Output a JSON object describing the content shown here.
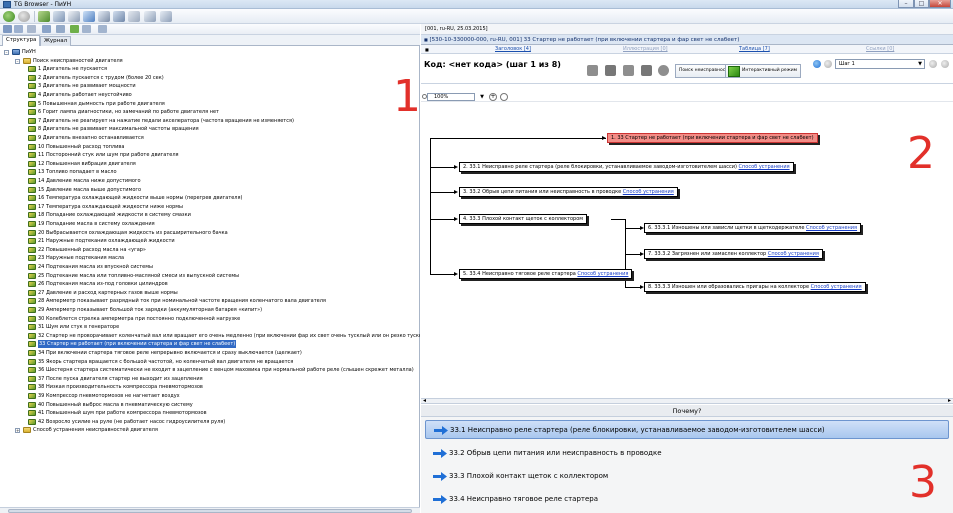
{
  "window": {
    "title": "TG Browser - ПиУН",
    "btn_min": "–",
    "btn_max": "□",
    "btn_close": "✕"
  },
  "left": {
    "tabs": [
      "Структура",
      "Журнал"
    ],
    "tree": [
      {
        "level": 0,
        "kind": "root",
        "label": "ПиУН",
        "exp": "–"
      },
      {
        "level": 1,
        "kind": "fold",
        "label": "Поиск неисправностей двигателя",
        "exp": "–"
      },
      {
        "level": 2,
        "kind": "leaf",
        "label": "1 Двигатель не пускается"
      },
      {
        "level": 2,
        "kind": "leaf",
        "label": "2 Двигатель пускается с трудом (более 20 сек)"
      },
      {
        "level": 2,
        "kind": "leaf",
        "label": "3 Двигатель не развивает мощности"
      },
      {
        "level": 2,
        "kind": "leaf",
        "label": "4 Двигатель работает неустойчиво"
      },
      {
        "level": 2,
        "kind": "leaf",
        "label": "5 Повышенная дымность при работе двигателя"
      },
      {
        "level": 2,
        "kind": "leaf",
        "label": "6 Горит лампа диагностики, но замечаний по работе двигателя нет"
      },
      {
        "level": 2,
        "kind": "leaf",
        "label": "7 Двигатель не реагирует на нажатие педали акселератора (частота вращения не изменяется)"
      },
      {
        "level": 2,
        "kind": "leaf",
        "label": "8 Двигатель не развивает максимальной частоты вращения"
      },
      {
        "level": 2,
        "kind": "leaf",
        "label": "9 Двигатель внезапно останавливается"
      },
      {
        "level": 2,
        "kind": "leaf",
        "label": "10 Повышенный расход топлива"
      },
      {
        "level": 2,
        "kind": "leaf",
        "label": "11 Посторонний стук или шум при работе двигателя"
      },
      {
        "level": 2,
        "kind": "leaf",
        "label": "12 Повышенная вибрация двигателя"
      },
      {
        "level": 2,
        "kind": "leaf",
        "label": "13 Топливо попадает в масло"
      },
      {
        "level": 2,
        "kind": "leaf",
        "label": "14 Давление масла ниже допустимого"
      },
      {
        "level": 2,
        "kind": "leaf",
        "label": "15 Давление масла выше допустимого"
      },
      {
        "level": 2,
        "kind": "leaf",
        "label": "16 Температура охлаждающей жидкости выше нормы (перегрев двигателя)"
      },
      {
        "level": 2,
        "kind": "leaf",
        "label": "17 Температура охлаждающей жидкости ниже нормы"
      },
      {
        "level": 2,
        "kind": "leaf",
        "label": "18 Попадание охлаждающей жидкости в систему смазки"
      },
      {
        "level": 2,
        "kind": "leaf",
        "label": "19 Попадание масла в систему охлаждения"
      },
      {
        "level": 2,
        "kind": "leaf",
        "label": "20 Выбрасывается охлаждающая жидкость из расширительного бачка"
      },
      {
        "level": 2,
        "kind": "leaf",
        "label": "21 Наружные подтекания охлаждающей жидкости"
      },
      {
        "level": 2,
        "kind": "leaf",
        "label": "22 Повышенный расход масла на «угар»"
      },
      {
        "level": 2,
        "kind": "leaf",
        "label": "23 Наружные подтекания масла"
      },
      {
        "level": 2,
        "kind": "leaf",
        "label": "24 Подтекания масла из впускной системы"
      },
      {
        "level": 2,
        "kind": "leaf",
        "label": "25 Подтекание масла или топливно-масляной смеси из выпускной системы"
      },
      {
        "level": 2,
        "kind": "leaf",
        "label": "26 Подтекания масла из-под головки цилиндров"
      },
      {
        "level": 2,
        "kind": "leaf",
        "label": "27 Давление и расход картерных газов выше нормы"
      },
      {
        "level": 2,
        "kind": "leaf",
        "label": "28 Амперметр показывает разрядный ток при номинальной частоте вращения коленчатого вала двигателя"
      },
      {
        "level": 2,
        "kind": "leaf",
        "label": "29 Амперметр показывает большой ток зарядки (аккумуляторная батарея «кипит»)"
      },
      {
        "level": 2,
        "kind": "leaf",
        "label": "30 Колеблется стрелка амперметра при постоянно подключенной нагрузке"
      },
      {
        "level": 2,
        "kind": "leaf",
        "label": "31 Шум или стук в генераторе"
      },
      {
        "level": 2,
        "kind": "leaf",
        "label": "32 Стартер не проворачивает коленчатый вал или вращает его очень медленно (при включении фар их свет очень тусклый или он резко тускнеет)"
      },
      {
        "level": 2,
        "kind": "leaf",
        "label": "33 Стартер не работает (при включении стартера и фар свет не слабеет)",
        "selected": true
      },
      {
        "level": 2,
        "kind": "leaf",
        "label": "34 При включении стартера тяговое реле непрерывно включается и сразу выключается (щелкает)"
      },
      {
        "level": 2,
        "kind": "leaf",
        "label": "35 Якорь стартера вращается с большой частотой, но коленчатый вал двигателя не вращается"
      },
      {
        "level": 2,
        "kind": "leaf",
        "label": "36 Шестерня стартера систематически не входит в зацепление с венцом маховика при нормальной работе реле (слышен скрежет металла)"
      },
      {
        "level": 2,
        "kind": "leaf",
        "label": "37 После пуска двигателя стартер не выходит из зацепления"
      },
      {
        "level": 2,
        "kind": "leaf",
        "label": "38 Низкая производительность компрессора пневмотормозов"
      },
      {
        "level": 2,
        "kind": "leaf",
        "label": "39 Компрессор пневмотормозов не нагнетает воздух"
      },
      {
        "level": 2,
        "kind": "leaf",
        "label": "40 Повышенный выброс масла в пневматическую систему"
      },
      {
        "level": 2,
        "kind": "leaf",
        "label": "41 Повышенный шум при работе компрессора пневмотормозов"
      },
      {
        "level": 2,
        "kind": "leaf",
        "label": "42 Возросло усилие на руле (не работает насос гидроусилителя руля)"
      },
      {
        "level": 1,
        "kind": "fold",
        "label": "Способ устранения неисправностей двигателя",
        "exp": "+"
      }
    ]
  },
  "annotations": {
    "n1": "1",
    "n2": "2",
    "n3": "3"
  },
  "right": {
    "path": "[001, ru-RU, 25.03.2015]",
    "header": "[530-10-330000-000, ru-RU, 001] 33 Стартер не работает (при включении стартера и фар свет не слабеет)",
    "header_marker": "■",
    "columns": {
      "marker": "■",
      "zagolovok": "Заголовок [4]",
      "illyustracii": "Иллюстрация [0]",
      "tablicy": "Таблица [7]",
      "ssylki": "Ссылки [0]"
    },
    "buttons": {
      "search": "Поиск неисправности",
      "interactive": "Интерактивный режим"
    },
    "code_label": "Код: <нет кода> (шаг 1 из 8)",
    "step_select": "Шаг 1",
    "select_arrow": "▼",
    "zoom": {
      "value": "100%",
      "arrow": "▼",
      "plus": "+"
    },
    "scroll_left": "◂",
    "scroll_right": "▸",
    "diagram": {
      "root": "1. 33 Стартер не работает (при включении стартера и фар свет не слабеет)",
      "link": "Способ устранения",
      "nodes": [
        {
          "id": "n2",
          "text": "2. 33.1 Неисправно реле стартера (реле блокировки, устанавливаемое заводом-изготовителем шасси)"
        },
        {
          "id": "n3",
          "text": "3. 33.2 Обрыв цепи питания или неисправность в проводке"
        },
        {
          "id": "n4",
          "text": "4. 33.3 Плохой контакт щеток с коллектором"
        },
        {
          "id": "n6",
          "text": "6. 33.3.1 Изношены или зависли щетки в щеткодержателе"
        },
        {
          "id": "n7",
          "text": "7. 33.3.2 Загрязнен или замаслен коллектор"
        },
        {
          "id": "n8",
          "text": "8. 33.3.3 Изношен или образовались пригары на коллекторе"
        },
        {
          "id": "n5",
          "text": "5. 33.4 Неисправно тяговое реле стартера"
        }
      ]
    },
    "why": "Почему?",
    "reasons": [
      "33.1 Неисправно реле стартера (реле блокировки, устанавливаемое заводом-изготовителем шасси)",
      "33.2 Обрыв цепи питания или неисправность в проводке",
      "33.3 Плохой контакт щеток с коллектором",
      "33.4 Неисправно тяговое реле стартера"
    ]
  },
  "colors": {
    "accent": "#316ac5",
    "root_node": "#f28c86",
    "annotation": "#e2302a",
    "reason_arrow": "#1f6fd6"
  }
}
